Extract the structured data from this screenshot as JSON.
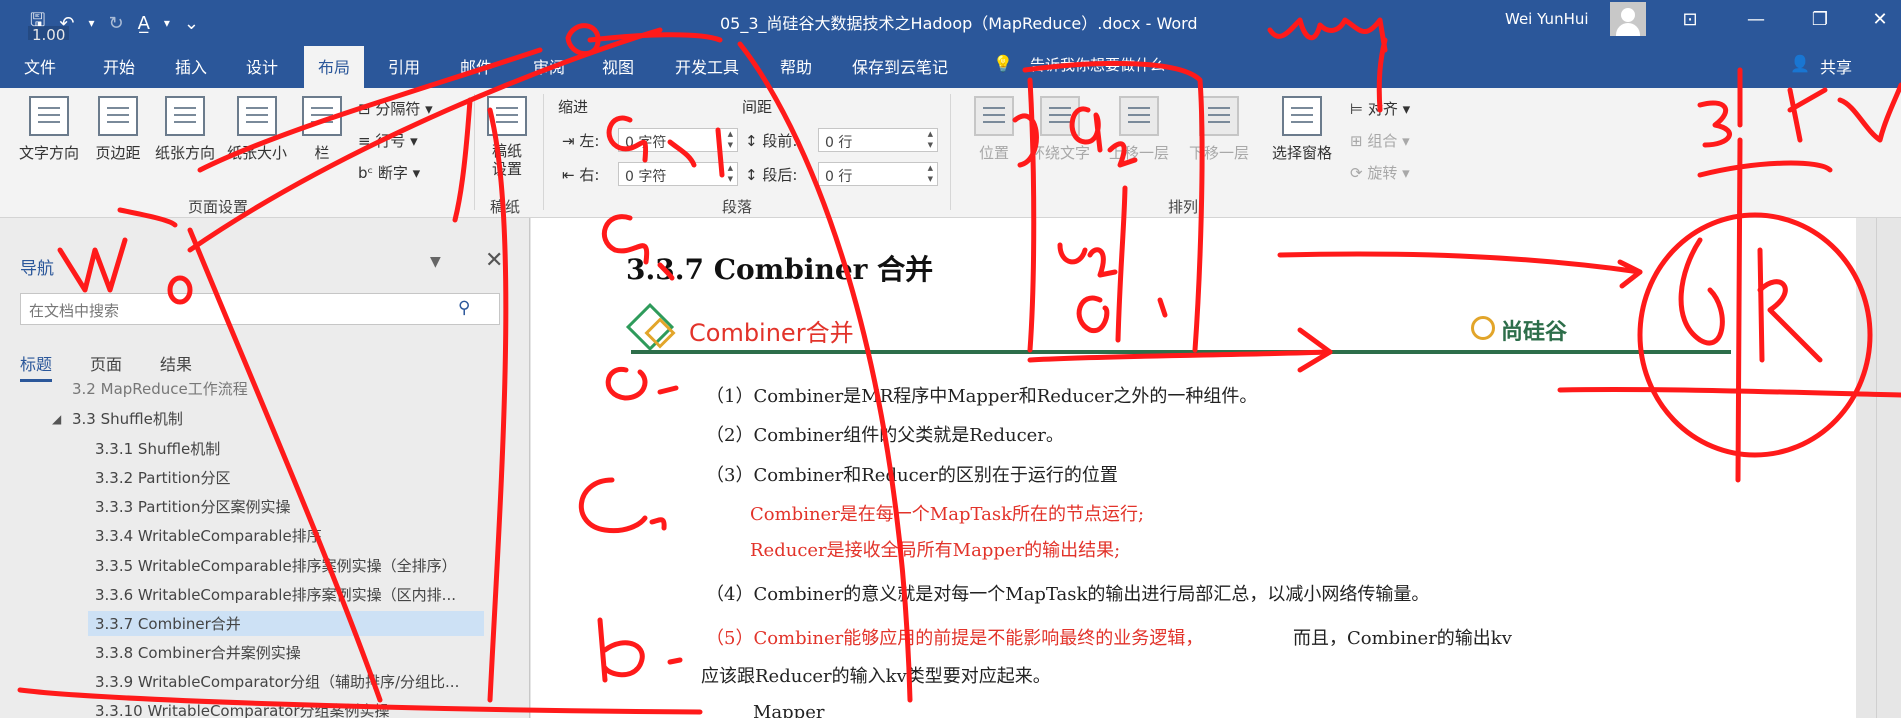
{
  "titlebar": {
    "quick_access": {
      "save": "🖫",
      "undo": "↶",
      "undo_dd": "▾",
      "redo": "↻",
      "format": "A̲",
      "format_dd": "▾",
      "customize": "⌄"
    },
    "zoom": "1.00",
    "document_title": "05_3_尚硅谷大数据技术之Hadoop（MapReduce）.docx - Word",
    "user_name": "Wei YunHui",
    "ribbon_display": "⊡",
    "minimize": "—",
    "restore": "❐",
    "close": "✕"
  },
  "tabs": {
    "items": [
      "文件",
      "开始",
      "插入",
      "设计",
      "布局",
      "引用",
      "邮件",
      "审阅",
      "视图",
      "开发工具",
      "帮助",
      "保存到云笔记"
    ],
    "active": "布局",
    "tell_me": "告诉我你想要做什么",
    "bulb": "💡",
    "share": "共享",
    "share_icon": "👤"
  },
  "ribbon": {
    "page_setup": {
      "text_direction": "文字方向",
      "margins": "页边距",
      "orientation": "纸张方向",
      "size": "纸张大小",
      "columns": "栏",
      "breaks": "分隔符",
      "line_numbers": "行号",
      "hyphenation": "断字",
      "group_label": "页面设置"
    },
    "manuscript": {
      "label": "稿纸\n设置",
      "group_label": "稿纸"
    },
    "paragraph": {
      "indent_label": "缩进",
      "spacing_label": "间距",
      "left_label": "左:",
      "right_label": "右:",
      "left_value": "0 字符",
      "right_value": "0 字符",
      "before_label": "段前:",
      "after_label": "段后:",
      "before_value": "0 行",
      "after_value": "0 行",
      "group_label": "段落"
    },
    "arrange": {
      "position": "位置",
      "wrap_text": "环绕文字",
      "bring_forward": "上移一层",
      "send_backward": "下移一层",
      "selection_pane": "选择窗格",
      "align": "对齐",
      "group": "组合",
      "rotate": "旋转",
      "group_label": "排列"
    }
  },
  "navigation": {
    "title": "导航",
    "options_icon": "▼",
    "close_icon": "✕",
    "search_placeholder": "在文档中搜索",
    "search_icon": "⚲",
    "tabs": [
      "标题",
      "页面",
      "结果"
    ],
    "items": [
      {
        "label": "3.2 MapReduce工作流程",
        "level": 2
      },
      {
        "label": "3.3 Shuffle机制",
        "level": 2,
        "expanded": true
      },
      {
        "label": "3.3.1 Shuffle机制",
        "level": 3
      },
      {
        "label": "3.3.2 Partition分区",
        "level": 3
      },
      {
        "label": "3.3.3 Partition分区案例实操",
        "level": 3
      },
      {
        "label": "3.3.4 WritableComparable排序",
        "level": 3
      },
      {
        "label": "3.3.5 WritableComparable排序案例实操（全排序）",
        "level": 3
      },
      {
        "label": "3.3.6 WritableComparable排序案例实操（区内排...",
        "level": 3
      },
      {
        "label": "3.3.7 Combiner合并",
        "level": 3,
        "selected": true
      },
      {
        "label": "3.3.8 Combiner合并案例实操",
        "level": 3
      },
      {
        "label": "3.3.9 WritableComparator分组（辅助排序/分组比...",
        "level": 3
      },
      {
        "label": "3.3.10 WritableComparator分组案例实操",
        "level": 3
      }
    ]
  },
  "document": {
    "heading": "3.3.7 Combiner 合并",
    "banner_title": "Combiner合并",
    "brand": "尚硅谷",
    "paragraphs": [
      {
        "text": "（1）Combiner是MR程序中Mapper和Reducer之外的一种组件。",
        "red": false
      },
      {
        "text": "（2）Combiner组件的父类就是Reducer。",
        "red": false
      },
      {
        "text": "（3）Combiner和Reducer的区别在于运行的位置",
        "red": false
      },
      {
        "text": "Combiner是在每一个MapTask所在的节点运行;",
        "red": true
      },
      {
        "text": "Reducer是接收全局所有Mapper的输出结果;",
        "red": true
      },
      {
        "text": "（4）Combiner的意义就是对每一个MapTask的输出进行局部汇总，以减小网络传输量。",
        "red": false
      },
      {
        "text": "（5）Combiner能够应用的前提是不能影响最终的业务逻辑，",
        "red": true
      },
      {
        "text": "而且，Combiner的输出kv",
        "red": false
      },
      {
        "text": "应该跟Reducer的输入kv类型要对应起来。",
        "red": false
      },
      {
        "text": "Mapper",
        "red": false
      }
    ]
  },
  "ink_color": "#ff1a1a"
}
